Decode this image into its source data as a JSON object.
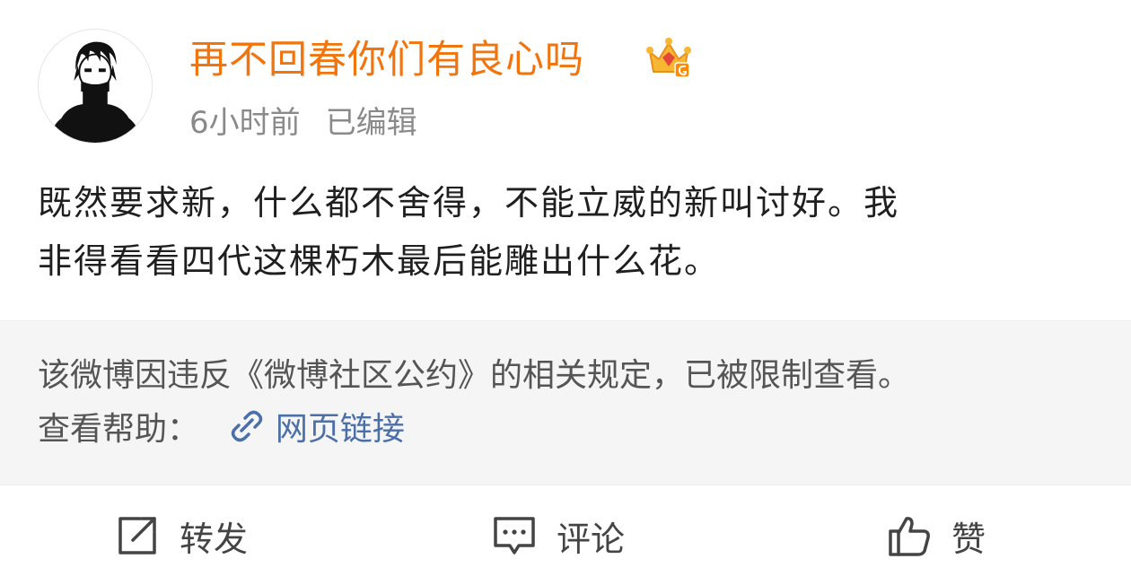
{
  "post": {
    "author": {
      "name": "再不回春你们有良心吗",
      "avatar_icon": "avatar-portrait-icon",
      "badge_icon": "crown-member-icon",
      "name_color": "#f2740d"
    },
    "time": "6小时前",
    "edited": "已编辑",
    "content_lines": [
      "既然要求新，什么都不舍得，不能立威的新叫讨好。我",
      "非得看看四代这棵朽木最后能雕出什么花。"
    ]
  },
  "notice": {
    "text": "该微博因违反《微博社区公约》的相关规定，已被限制查看。",
    "help_label": "查看帮助：",
    "link_icon": "link-icon",
    "link_text": "网页链接",
    "link_color": "#4c6fa8"
  },
  "actions": {
    "repost": {
      "icon": "repost-icon",
      "label": "转发"
    },
    "comment": {
      "icon": "comment-icon",
      "label": "评论"
    },
    "like": {
      "icon": "thumbs-up-icon",
      "label": "赞"
    }
  }
}
